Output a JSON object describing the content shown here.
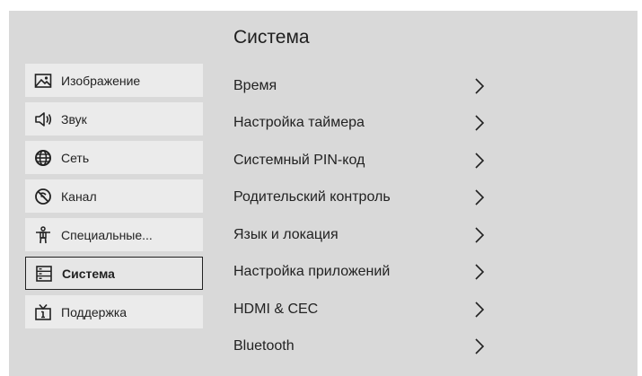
{
  "title": "Система",
  "sidebar": {
    "items": [
      {
        "label": "Изображение",
        "icon": "picture-icon"
      },
      {
        "label": "Звук",
        "icon": "speaker-icon"
      },
      {
        "label": "Сеть",
        "icon": "globe-icon"
      },
      {
        "label": "Канал",
        "icon": "channel-icon"
      },
      {
        "label": "Специальные...",
        "icon": "accessibility-icon"
      },
      {
        "label": "Система",
        "icon": "system-icon",
        "active": true
      },
      {
        "label": "Поддержка",
        "icon": "tv-info-icon"
      }
    ]
  },
  "menu": {
    "items": [
      {
        "label": "Время"
      },
      {
        "label": "Настройка таймера"
      },
      {
        "label": "Системный PIN-код"
      },
      {
        "label": "Родительский контроль"
      },
      {
        "label": "Язык и локация"
      },
      {
        "label": "Настройка приложений"
      },
      {
        "label": "HDMI & CEC"
      },
      {
        "label": "Bluetooth"
      }
    ]
  },
  "colors": {
    "background": "#d9d9d9",
    "item_bg": "#ebebeb",
    "text": "#222222"
  }
}
